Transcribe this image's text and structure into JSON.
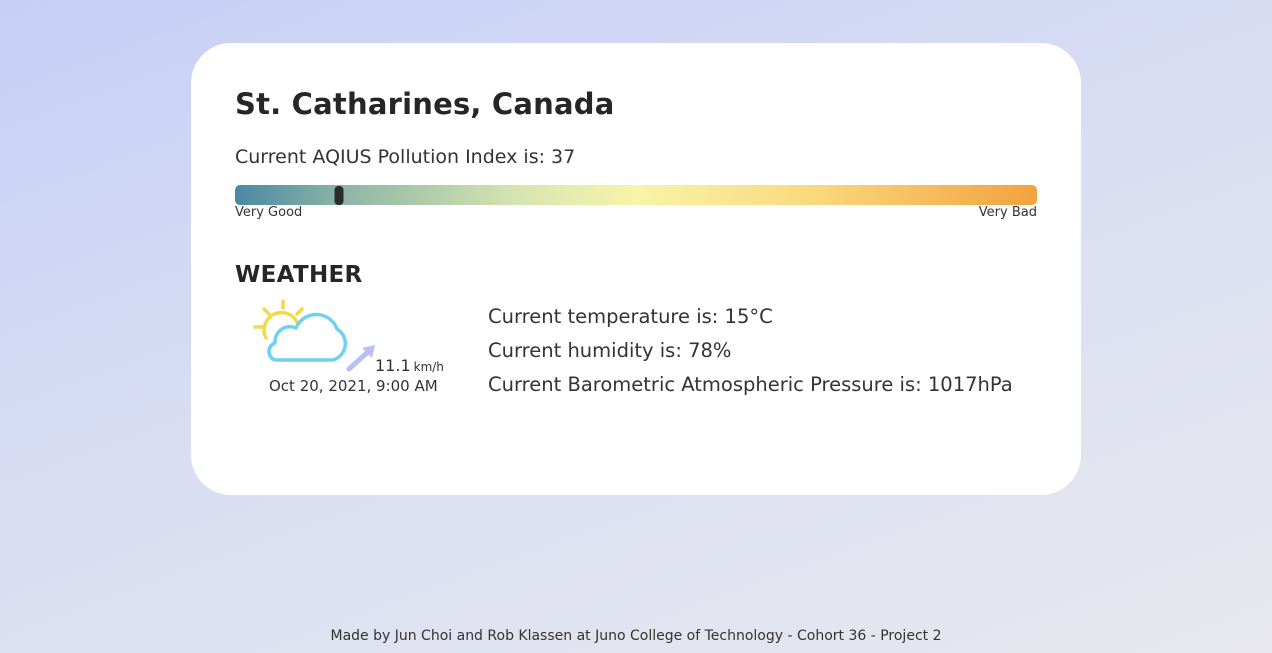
{
  "location": {
    "title": "St. Catharines, Canada"
  },
  "air_quality": {
    "label": "Current AQIUS Pollution Index is: 37",
    "index_value": 37,
    "marker_fraction": 0.13,
    "scale_low_label": "Very Good",
    "scale_high_label": "Very Bad",
    "gradient_colors": [
      "#4a88a3",
      "#8fb7a6",
      "#d6e4b0",
      "#f8f4a8",
      "#f9d97c",
      "#f3a23f"
    ]
  },
  "weather": {
    "heading": "WEATHER",
    "icon": "partly-cloudy-icon",
    "wind_icon": "wind-direction-arrow-icon",
    "wind_speed": "11.1",
    "wind_unit": "km/h",
    "timestamp": "Oct 20, 2021, 9:00 AM",
    "temperature": "Current temperature is: 15°C",
    "humidity": "Current humidity is: 78%",
    "pressure": "Current Barometric Atmospheric Pressure is: 1017hPa",
    "colors": {
      "sun": "#f5d94a",
      "cloud": "#6fd0f2",
      "arrow": "#b8c0f2"
    }
  },
  "footer": {
    "credits": "Made by Jun Choi and Rob Klassen at Juno College of Technology - Cohort 36 - Project 2"
  }
}
